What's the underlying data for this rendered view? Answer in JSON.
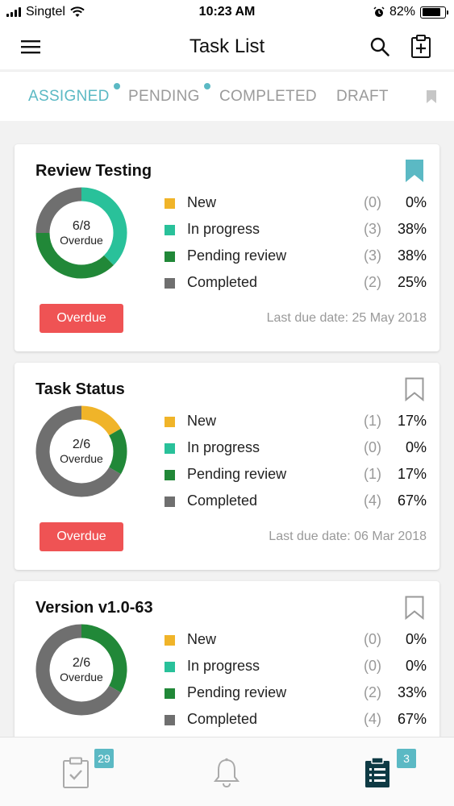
{
  "status_bar": {
    "carrier": "Singtel",
    "time": "10:23 AM",
    "battery": "82%",
    "battery_level": 0.82
  },
  "header": {
    "title": "Task List"
  },
  "tabs": [
    {
      "label": "ASSIGNED",
      "active": true,
      "dot": true
    },
    {
      "label": "PENDING",
      "active": false,
      "dot": true
    },
    {
      "label": "COMPLETED",
      "active": false,
      "dot": false
    },
    {
      "label": "DRAFT",
      "active": false,
      "dot": false
    }
  ],
  "colors": {
    "accent": "#5bb9c4",
    "new": "#f0b429",
    "in_progress": "#29c19a",
    "pending_review": "#218838",
    "completed": "#6f6f6f",
    "overdue": "#ef5354"
  },
  "cards": [
    {
      "title": "Review Testing",
      "bookmarked": true,
      "donut": {
        "fraction": "6/8",
        "sub": "Overdue"
      },
      "status_button": "Overdue",
      "legend": [
        {
          "label": "New",
          "count": "(0)",
          "percent": "0%"
        },
        {
          "label": "In progress",
          "count": "(3)",
          "percent": "38%"
        },
        {
          "label": "Pending review",
          "count": "(3)",
          "percent": "38%"
        },
        {
          "label": "Completed",
          "count": "(2)",
          "percent": "25%"
        }
      ],
      "due_date": "Last due date: 25 May 2018"
    },
    {
      "title": "Task Status",
      "bookmarked": false,
      "donut": {
        "fraction": "2/6",
        "sub": "Overdue"
      },
      "status_button": "Overdue",
      "legend": [
        {
          "label": "New",
          "count": "(1)",
          "percent": "17%"
        },
        {
          "label": "In progress",
          "count": "(0)",
          "percent": "0%"
        },
        {
          "label": "Pending review",
          "count": "(1)",
          "percent": "17%"
        },
        {
          "label": "Completed",
          "count": "(4)",
          "percent": "67%"
        }
      ],
      "due_date": "Last due date: 06 Mar 2018"
    },
    {
      "title": "Version v1.0-63",
      "bookmarked": false,
      "donut": {
        "fraction": "2/6",
        "sub": "Overdue"
      },
      "status_button": "",
      "legend": [
        {
          "label": "New",
          "count": "(0)",
          "percent": "0%"
        },
        {
          "label": "In progress",
          "count": "(0)",
          "percent": "0%"
        },
        {
          "label": "Pending review",
          "count": "(2)",
          "percent": "33%"
        },
        {
          "label": "Completed",
          "count": "(4)",
          "percent": "67%"
        }
      ],
      "due_date": ""
    }
  ],
  "bottom_nav": [
    {
      "icon": "task-check-icon",
      "badge": "29",
      "active": false
    },
    {
      "icon": "bell-icon",
      "badge": "",
      "active": false
    },
    {
      "icon": "task-list-icon",
      "badge": "3",
      "active": true
    }
  ],
  "chart_data": [
    {
      "type": "pie",
      "title": "Review Testing",
      "categories": [
        "New",
        "In progress",
        "Pending review",
        "Completed"
      ],
      "values": [
        0,
        3,
        3,
        2
      ]
    },
    {
      "type": "pie",
      "title": "Task Status",
      "categories": [
        "New",
        "In progress",
        "Pending review",
        "Completed"
      ],
      "values": [
        1,
        0,
        1,
        4
      ]
    },
    {
      "type": "pie",
      "title": "Version v1.0-63",
      "categories": [
        "New",
        "In progress",
        "Pending review",
        "Completed"
      ],
      "values": [
        0,
        0,
        2,
        4
      ]
    }
  ]
}
